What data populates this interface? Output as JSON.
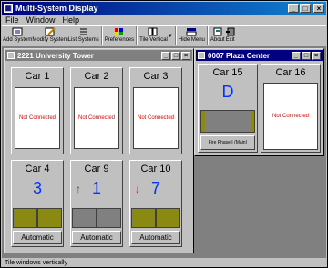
{
  "app": {
    "title": "Multi-System Display"
  },
  "menu": [
    "File",
    "Window",
    "Help"
  ],
  "toolbar": {
    "add_system": "Add System",
    "modify_system": "Modify System",
    "list_systems": "List Systems",
    "preferences": "Preferences",
    "tile_vertical": "Tile Vertical",
    "hide_menu": "Hide Menu",
    "about": "About",
    "exit": "Exit"
  },
  "status": {
    "text": "Tile windows vertically"
  },
  "windows": {
    "university": {
      "title": "2221  University Tower",
      "cars": {
        "car1": {
          "name": "Car  1",
          "status": "Not Connected"
        },
        "car2": {
          "name": "Car  2",
          "status": "Not Connected"
        },
        "car3": {
          "name": "Car  3",
          "status": "Not Connected"
        },
        "car4": {
          "name": "Car  4",
          "position": "3",
          "mode": "Automatic"
        },
        "car9": {
          "name": "Car  9",
          "position": "1",
          "direction": "up",
          "arrow": "↑",
          "mode": "Automatic"
        },
        "car10": {
          "name": "Car  10",
          "position": "7",
          "direction": "down",
          "arrow": "↓",
          "mode": "Automatic"
        }
      }
    },
    "plaza": {
      "title": "0007  Plaza Center",
      "cars": {
        "car15": {
          "name": "Car  15",
          "position": "D",
          "mode": "Fire Phase I (Main)"
        },
        "car16": {
          "name": "Car  16",
          "status": "Not Connected"
        }
      }
    }
  },
  "colors": {
    "title_active": "#000080",
    "title_inactive": "#808080",
    "position_blue": "#0033ff",
    "arrow_up": "#008000",
    "arrow_down": "#e00000",
    "not_connected": "#e00000",
    "door_open": "#8a8a12"
  }
}
